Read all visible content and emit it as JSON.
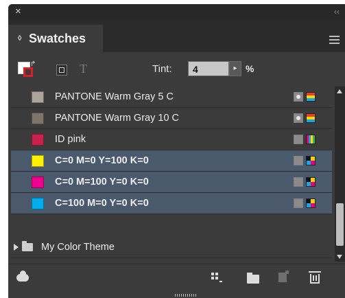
{
  "window": {
    "close_glyph": "×",
    "collapse_glyph": "‹‹"
  },
  "panel": {
    "tab_title": "Swatches",
    "tab_arrows_glyph": "◊"
  },
  "controls": {
    "text_glyph": "T",
    "tint_label": "Tint:",
    "tint_value": "4",
    "tint_arrow_glyph": "▸",
    "tint_unit": "%"
  },
  "swatches": [
    {
      "name": "PANTONE Warm Gray 5 C",
      "color": "#aca39a",
      "type_icon": "spot-color-icon",
      "mode_icon": "spot-mode-icon",
      "selected": false
    },
    {
      "name": "PANTONE Warm Gray 10 C",
      "color": "#7e7369",
      "type_icon": "spot-color-icon",
      "mode_icon": "spot-mode-icon",
      "selected": false
    },
    {
      "name": "ID pink",
      "color": "#c8214c",
      "type_icon": "process-color-icon",
      "mode_icon": "mixed-mode-icon",
      "selected": false
    },
    {
      "name": "C=0 M=0 Y=100 K=0",
      "color": "#fff100",
      "type_icon": "process-color-icon",
      "mode_icon": "cmyk-mode-icon",
      "selected": true
    },
    {
      "name": "C=0 M=100 Y=0 K=0",
      "color": "#ec008c",
      "type_icon": "process-color-icon",
      "mode_icon": "cmyk-mode-icon",
      "selected": true
    },
    {
      "name": "C=100 M=0 Y=0 K=0",
      "color": "#00aeef",
      "type_icon": "process-color-icon",
      "mode_icon": "cmyk-mode-icon",
      "selected": true
    }
  ],
  "color_group": {
    "name": "My Color Theme"
  },
  "colors": {
    "panel_bg": "#3b3b3b",
    "selection_bg": "#4a5a6c",
    "stroke_red": "#d62128"
  }
}
